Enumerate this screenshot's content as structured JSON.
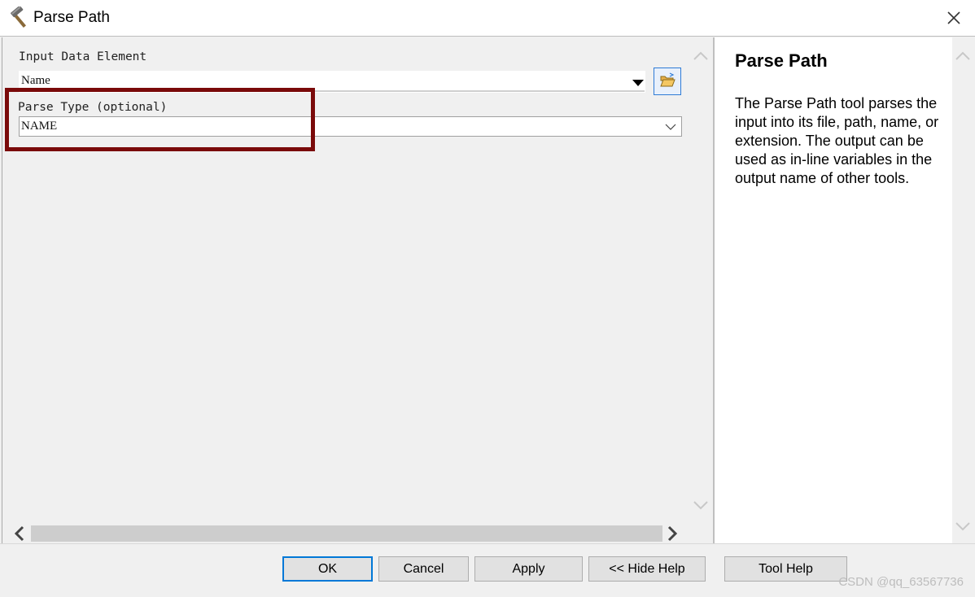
{
  "window": {
    "title": "Parse Path"
  },
  "form": {
    "input_data_element": {
      "label": "Input Data Element",
      "value": "Name"
    },
    "parse_type": {
      "label": "Parse Type (optional)",
      "value": "NAME"
    }
  },
  "help": {
    "title": "Parse Path",
    "body": "The Parse Path tool parses the input into its file, path, name, or extension. The output can be used as in-line variables in the output name of other tools."
  },
  "buttons": {
    "ok": "OK",
    "cancel": "Cancel",
    "apply": "Apply",
    "hide_help": "<< Hide Help",
    "tool_help": "Tool Help"
  },
  "watermark": "CSDN @qq_63567736",
  "colors": {
    "highlight_box": "#7a0a0a",
    "default_button_border": "#0078d7"
  },
  "icons": {
    "title": "hammer-icon",
    "close": "close-icon",
    "browse": "open-folder-icon"
  }
}
